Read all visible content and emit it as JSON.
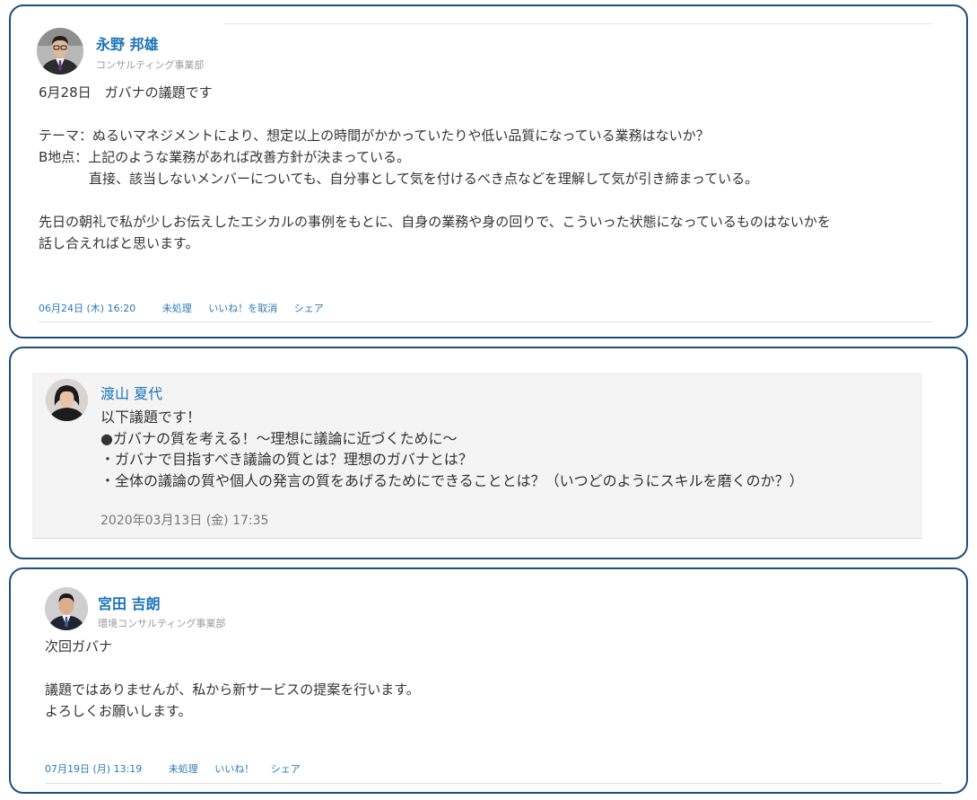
{
  "posts": [
    {
      "author": "永野 邦雄",
      "department": "コンサルティング事業部",
      "body_lines": [
        "6月28日　ガバナの議題です",
        "",
        "テーマ：ぬるいマネジメントにより、想定以上の時間がかかっていたりや低い品質になっている業務はないか？",
        "B地点：上記のような業務があれば改善方針が決まっている。",
        "直接、該当しないメンバーについても、自分事として気を付けるべき点などを理解して気が引き締まっている。",
        "",
        "先日の朝礼で私が少しお伝えしたエシカルの事例をもとに、自身の業務や身の回りで、こういった状態になっているものはないかを",
        "話し合えればと思います。"
      ],
      "timestamp": "06月24日 (木) 16:20",
      "status": "未処理",
      "like_label": "いいね！を取消",
      "share_label": "シェア"
    },
    {
      "comment": {
        "author": "渡山 夏代",
        "body_lines": [
          "以下議題です！",
          "●ガバナの質を考える！～理想に議論に近づくために～",
          "・ガバナで目指すべき議論の質とは？理想のガバナとは？",
          "・全体の議論の質や個人の発言の質をあげるためにできることとは？（いつどのようにスキルを磨くのか？）"
        ],
        "timestamp": "2020年03月13日 (金) 17:35"
      }
    },
    {
      "author": "宮田 吉朗",
      "department": "環境コンサルティング事業部",
      "body_lines": [
        "次回ガバナ",
        "",
        "議題ではありませんが、私から新サービスの提案を行います。",
        "よろしくお願いします。"
      ],
      "timestamp": "07月19日 (月) 13:19",
      "status": "未処理",
      "like_label": "いいね！",
      "share_label": "シェア"
    }
  ],
  "colors": {
    "card_border": "#1f4e79",
    "link": "#1a73b8",
    "meta_link": "#2a7ab8",
    "muted": "#9a9a9a",
    "comment_bg": "#f4f4f4"
  },
  "icons": [
    "avatar-man-suit",
    "avatar-woman",
    "avatar-man-suit"
  ]
}
